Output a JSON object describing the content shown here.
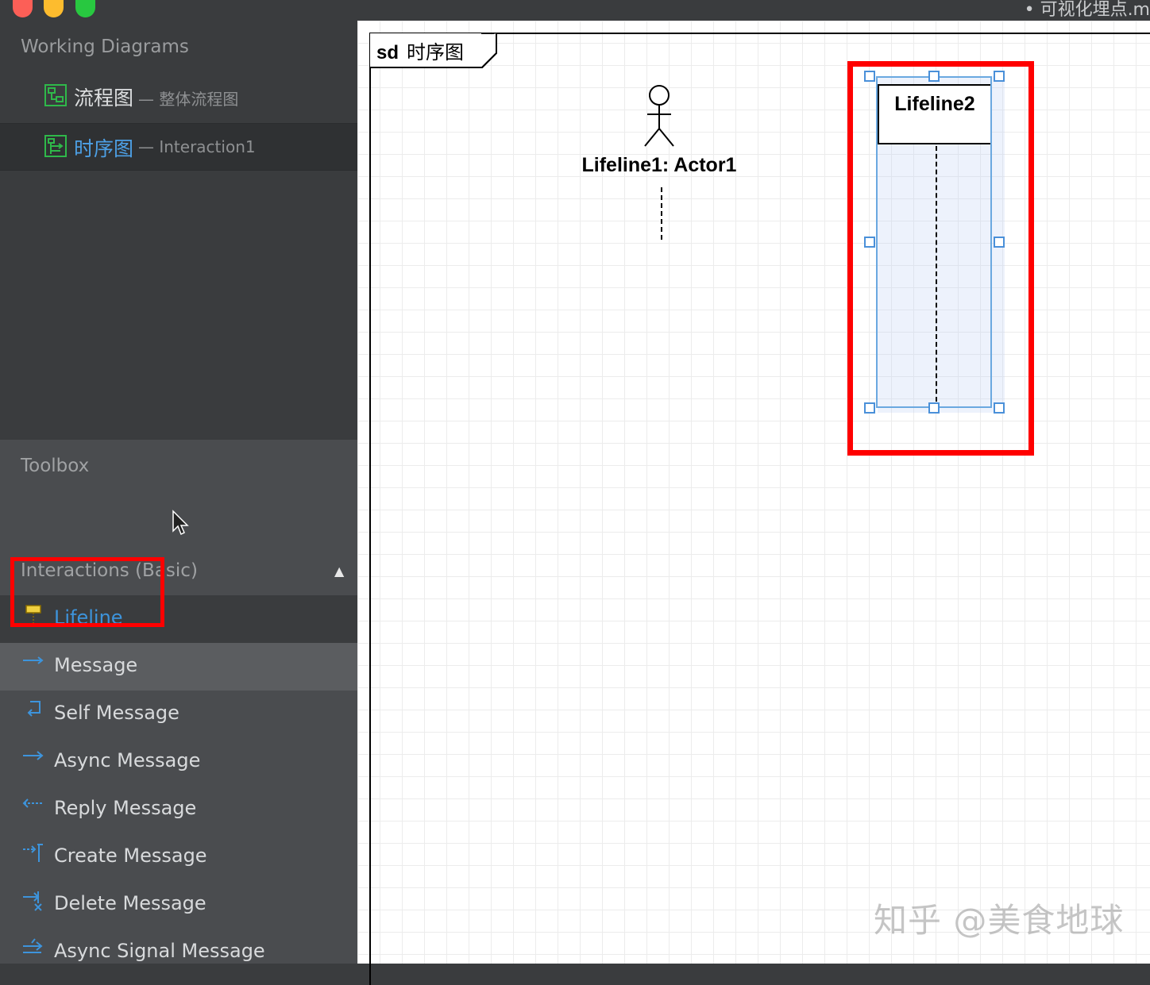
{
  "window": {
    "title": "• 可视化埋点.m"
  },
  "working_diagrams": {
    "header": "Working Diagrams",
    "items": [
      {
        "name": "流程图",
        "subtitle": "— 整体流程图",
        "icon": "flowchart-diagram-icon",
        "active": false
      },
      {
        "name": "时序图",
        "subtitle": "— Interaction1",
        "icon": "sequence-diagram-icon",
        "active": true
      }
    ]
  },
  "toolbox": {
    "header": "Toolbox",
    "group": "Interactions (Basic)",
    "collapse_glyph": "▲",
    "tools": [
      {
        "label": "Lifeline",
        "icon": "lifeline-icon"
      },
      {
        "label": "Message",
        "icon": "message-arrow-icon"
      },
      {
        "label": "Self Message",
        "icon": "self-message-icon"
      },
      {
        "label": "Async Message",
        "icon": "async-message-icon"
      },
      {
        "label": "Reply Message",
        "icon": "reply-message-icon"
      },
      {
        "label": "Create Message",
        "icon": "create-message-icon"
      },
      {
        "label": "Delete Message",
        "icon": "delete-message-icon"
      },
      {
        "label": "Async Signal Message",
        "icon": "async-signal-message-icon"
      }
    ]
  },
  "diagram": {
    "frame_kind": "sd",
    "frame_name": "时序图",
    "actor_lifeline": "Lifeline1: Actor1",
    "lifeline": "Lifeline2"
  },
  "watermark": "知乎 @美食地球",
  "colors": {
    "highlight_red": "#ff0000",
    "selection_blue": "#4a90d9",
    "active_text": "#3d94dc"
  }
}
